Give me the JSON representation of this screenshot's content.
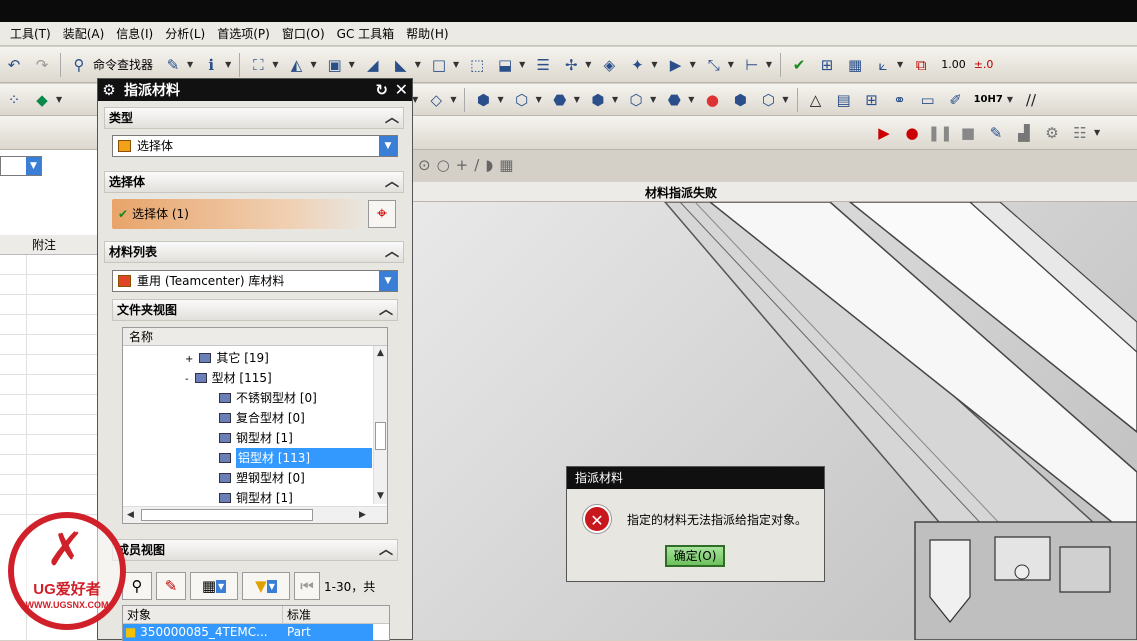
{
  "menubar": [
    "工具(T)",
    "装配(A)",
    "信息(I)",
    "分析(L)",
    "首选项(P)",
    "窗口(O)",
    "GC 工具箱",
    "帮助(H)"
  ],
  "toolbar": {
    "command_finder": "命令查找器",
    "precision_1": "1.00",
    "precision_2": "±.0",
    "tol_label": "10H7"
  },
  "left_grid": {
    "column_header": "附注"
  },
  "viewport": {
    "title": "材料指派失败"
  },
  "assign_dialog": {
    "title": "指派材料",
    "section_type": "类型",
    "type_value": "选择体",
    "section_select_body": "选择体",
    "select_body_value": "选择体 (1)",
    "section_material_list": "材料列表",
    "material_list_value": "重用 (Teamcenter) 库材料",
    "section_folder_view": "文件夹视图",
    "tree_header": "名称",
    "tree_items": [
      {
        "label": "其它 [19]",
        "expander": "+",
        "level": 0
      },
      {
        "label": "型材 [115]",
        "expander": "-",
        "level": 0
      },
      {
        "label": "不锈钢型材 [0]",
        "level": 1
      },
      {
        "label": "复合型材 [0]",
        "level": 1
      },
      {
        "label": "钢型材 [1]",
        "level": 1
      },
      {
        "label": "铝型材 [113]",
        "level": 1,
        "selected": true
      },
      {
        "label": "塑钢型材 [0]",
        "level": 1
      },
      {
        "label": "铜型材 [1]",
        "level": 1
      }
    ],
    "section_member_view": "成员视图",
    "paging": "1-30，共",
    "member_columns": [
      "对象",
      "标准"
    ],
    "member_rows": [
      {
        "object": "350000085_4TEMC...",
        "standard": "Part"
      }
    ]
  },
  "error_dialog": {
    "title": "指派材料",
    "message": "指定的材料无法指派给指定对象。",
    "ok_label": "确定(O)"
  },
  "watermark": {
    "brand": "UG爱好者",
    "url": "WWW.UGSNX.COM"
  }
}
